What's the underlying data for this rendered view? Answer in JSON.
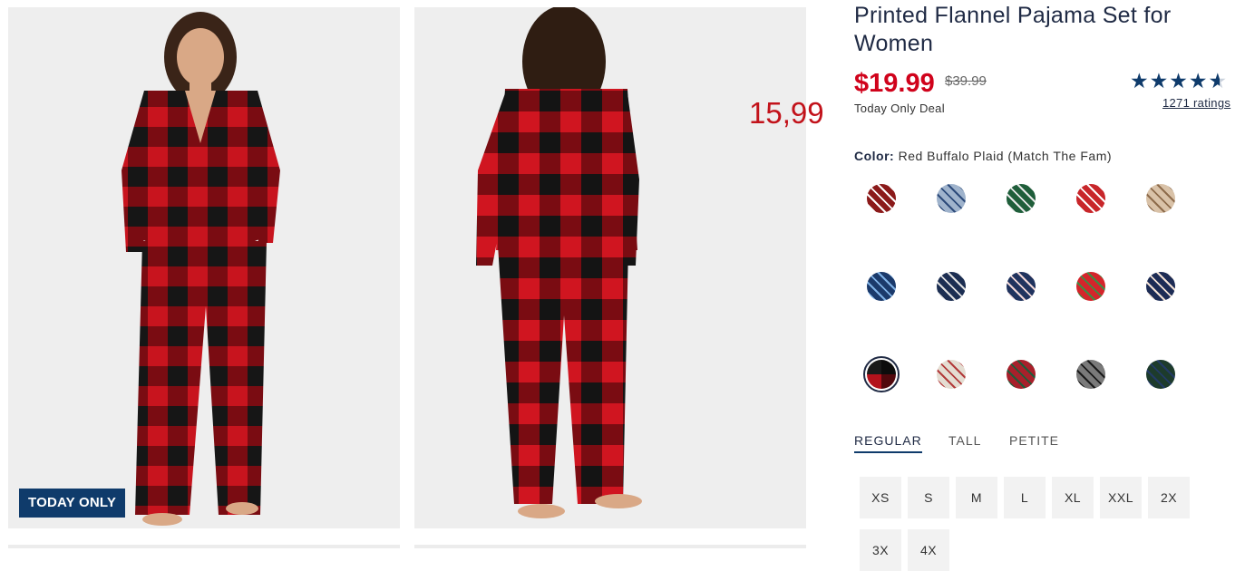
{
  "badge": "TODAY ONLY",
  "overlay_price": "15,99",
  "product": {
    "title": "Printed Flannel Pajama Set for Women",
    "price": "$19.99",
    "old_price": "$39.99",
    "deal": "Today Only Deal",
    "rating_value": 4.5,
    "ratings_link": "1271 ratings"
  },
  "color": {
    "label": "Color:",
    "selected": "Red Buffalo Plaid (Match The Fam)"
  },
  "swatches": [
    {
      "name": "red-holiday-print",
      "base": "#8b1a1a",
      "accent": "#ffffff"
    },
    {
      "name": "blue-plaid",
      "base": "#9fb3cc",
      "accent": "#2c4a7a"
    },
    {
      "name": "green-print",
      "base": "#1f5e3a",
      "accent": "#e8e8e8"
    },
    {
      "name": "red-fairisle",
      "base": "#c8262a",
      "accent": "#ffffff"
    },
    {
      "name": "tan-plaid",
      "base": "#d9c2a8",
      "accent": "#8d6b4b"
    },
    {
      "name": "blue-print",
      "base": "#1b3a6b",
      "accent": "#7fb2e6"
    },
    {
      "name": "navy-santa",
      "base": "#1c2e52",
      "accent": "#e0e0e0"
    },
    {
      "name": "navy-gnome",
      "base": "#20335e",
      "accent": "#f0d6d6"
    },
    {
      "name": "red-tree",
      "base": "#d4252b",
      "accent": "#3e8b45"
    },
    {
      "name": "navy-santa-face",
      "base": "#1d2c55",
      "accent": "#f3e1d4"
    },
    {
      "name": "red-buffalo-plaid",
      "base": "#b3121c",
      "accent": "#1a1a1a"
    },
    {
      "name": "cream-red-plaid",
      "base": "#e4ddd2",
      "accent": "#b23a3a"
    },
    {
      "name": "red-green-tartan",
      "base": "#a8202b",
      "accent": "#1f5b3a"
    },
    {
      "name": "grey-black-check",
      "base": "#7a7a7a",
      "accent": "#1a1a1a"
    },
    {
      "name": "green-navy-tartan",
      "base": "#1d3b2c",
      "accent": "#223a66"
    }
  ],
  "fit_tabs": [
    "REGULAR",
    "TALL",
    "PETITE"
  ],
  "sizes": [
    "XS",
    "S",
    "M",
    "L",
    "XL",
    "XXL",
    "2X",
    "3X",
    "4X"
  ]
}
